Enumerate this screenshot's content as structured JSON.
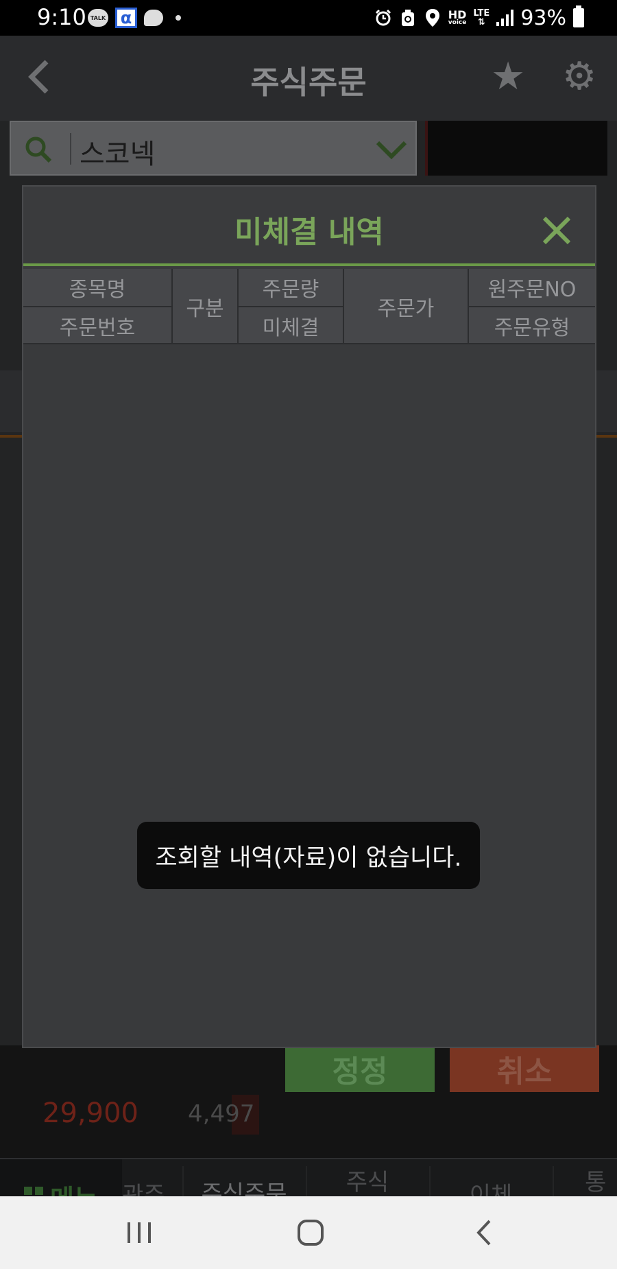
{
  "status_bar": {
    "time": "9:10",
    "talk_label": "TALK",
    "battery_percent": "93%",
    "hd_label": "HD",
    "voice_label": "voice",
    "lte_label": "LTE",
    "left_icons": [
      "kakaotalk-icon",
      "alpha-app-icon",
      "chat-bubble-icon",
      "dot-icon"
    ],
    "right_icons": [
      "alarm-icon",
      "recycle-icon",
      "location-icon",
      "hd-voice-icon",
      "lte-icon",
      "signal-icon",
      "battery-icon"
    ]
  },
  "header": {
    "title": "주식주문",
    "back_icon": "chevron-left-icon",
    "star_icon": "star-icon",
    "settings_icon": "gear-icon"
  },
  "search": {
    "value": "스코넥",
    "icon": "search-icon",
    "dropdown_icon": "chevron-down-icon"
  },
  "background": {
    "modify_button": "정정",
    "cancel_button": "취소",
    "price": "29,900",
    "quantity": "4,497"
  },
  "bottom_nav": {
    "menu_label": "메뉴",
    "items": [
      {
        "label": "관주",
        "active": false
      },
      {
        "label": "주식주문",
        "active": true
      },
      {
        "label": "주식\n체결/잔고",
        "active": false
      },
      {
        "label": "이체",
        "active": false
      },
      {
        "label": "통\n거래",
        "active": false
      }
    ]
  },
  "modal": {
    "title": "미체결 내역",
    "close_icon": "close-icon",
    "columns": {
      "stock_name": "종목명",
      "order_number": "주문번호",
      "type": "구분",
      "order_qty": "주문량",
      "unfilled": "미체결",
      "order_price": "주문가",
      "original_order_no": "원주문NO",
      "order_type": "주문유형"
    },
    "rows": []
  },
  "toast": {
    "message": "조회할 내역(자료)이 없습니다."
  },
  "system_nav": {
    "recents_icon": "recents-icon",
    "home_icon": "home-icon",
    "back_icon": "back-icon"
  },
  "colors": {
    "accent_green": "#7aa55a",
    "modal_bg": "#3a3b3d",
    "toast_bg": "#0c0c0c"
  }
}
